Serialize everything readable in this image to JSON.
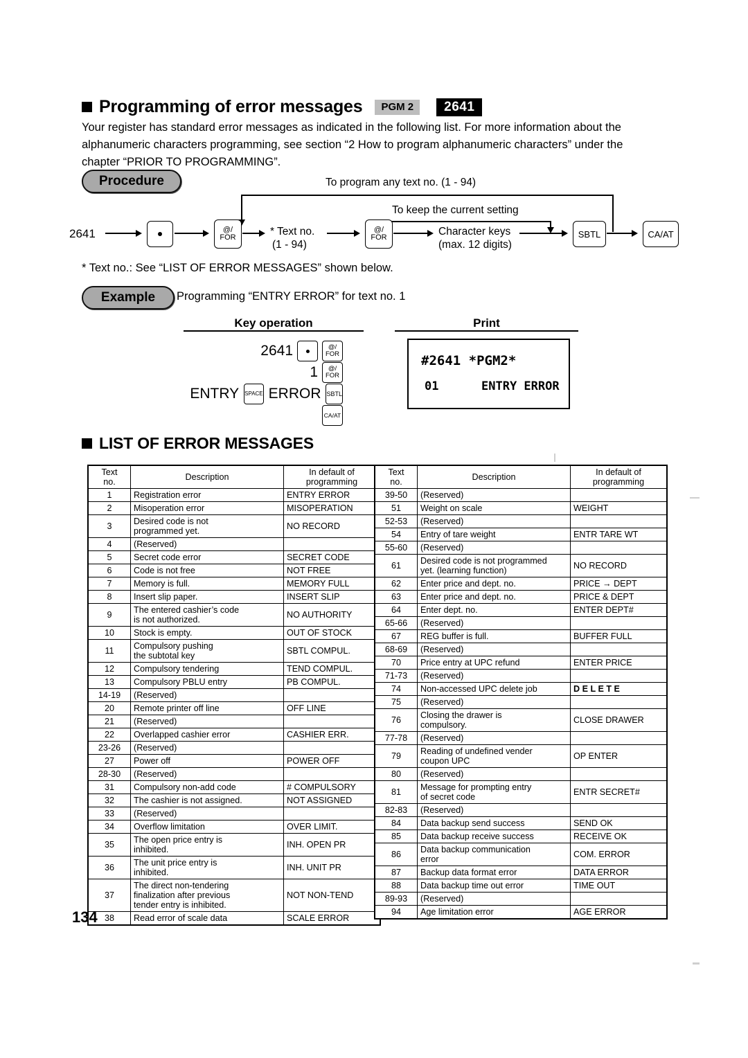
{
  "heading": {
    "title": "Programming of error messages",
    "badge_mode": "PGM 2",
    "badge_code": "2641",
    "bullet": "black-square"
  },
  "intro": "Your register has standard error messages as indicated in the following list. For more information about the alphanumeric characters programming, see section “2 How to program alphanumeric characters” under the chapter “PRIOR TO PROGRAMMING”.",
  "procedure": {
    "label": "Procedure",
    "start_code": "2641",
    "loop_top_label": "To program any text no. (1 - 94)",
    "loop_inner_label": "To keep the current setting",
    "keys": {
      "point": "•",
      "for1_top": "@/",
      "for1_bottom": "FOR",
      "for2_top": "@/",
      "for2_bottom": "FOR",
      "sbtl": "SBTL",
      "caat": "CA/AT"
    },
    "text_no_line1": "* Text no.",
    "text_no_line2": "(1 - 94)",
    "char_keys_line1": "Character keys",
    "char_keys_line2": "(max. 12 digits)",
    "footnote": "*  Text no.: See “LIST OF ERROR MESSAGES” shown below."
  },
  "example": {
    "label": "Example",
    "description": "Programming “ENTRY ERROR” for text no. 1",
    "key_operation_header": "Key operation",
    "print_header": "Print",
    "key_lines": [
      {
        "text": "2641",
        "keys": [
          "dot",
          "for"
        ]
      },
      {
        "text": "1",
        "keys": [
          "for"
        ]
      },
      {
        "text": "ENTRY",
        "keys": [
          "space"
        ],
        "text2": "ERROR",
        "keys2": [
          "sbtl"
        ]
      },
      {
        "text": "",
        "keys": [
          "caat"
        ]
      }
    ],
    "key_labels": {
      "dot": "•",
      "for_top": "@/",
      "for_bottom": "FOR",
      "space": "SPACE",
      "sbtl": "SBTL",
      "caat": "CA/AT"
    },
    "print": {
      "line1": "#2641 *PGM2*",
      "line2_left": "01",
      "line2_right": "ENTRY ERROR"
    }
  },
  "list_heading": "LIST OF ERROR MESSAGES",
  "table_headers": {
    "no": "Text\nno.",
    "no_line1": "Text",
    "no_line2": "no.",
    "description": "Description",
    "default_line1": "In default of",
    "default_line2": "programming"
  },
  "table_left": [
    {
      "no": "1",
      "desc": "Registration error",
      "def": "ENTRY ERROR"
    },
    {
      "no": "2",
      "desc": "Misoperation error",
      "def": "MISOPERATION"
    },
    {
      "no": "3",
      "desc": "Desired code is not\nprogrammed yet.",
      "def": "NO RECORD"
    },
    {
      "no": "4",
      "desc": "(Reserved)",
      "def": ""
    },
    {
      "no": "5",
      "desc": "Secret code error",
      "def": "SECRET CODE"
    },
    {
      "no": "6",
      "desc": "Code is not free",
      "def": "NOT FREE"
    },
    {
      "no": "7",
      "desc": "Memory is full.",
      "def": "MEMORY FULL"
    },
    {
      "no": "8",
      "desc": "Insert slip paper.",
      "def": "INSERT SLIP"
    },
    {
      "no": "9",
      "desc": "The entered cashier’s code\nis not authorized.",
      "def": "NO AUTHORITY"
    },
    {
      "no": "10",
      "desc": "Stock is empty.",
      "def": "OUT OF STOCK"
    },
    {
      "no": "11",
      "desc": "Compulsory pushing\nthe subtotal key",
      "def": "SBTL COMPUL."
    },
    {
      "no": "12",
      "desc": "Compulsory tendering",
      "def": "TEND COMPUL."
    },
    {
      "no": "13",
      "desc": "Compulsory PBLU entry",
      "def": "PB COMPUL."
    },
    {
      "no": "14-19",
      "desc": "(Reserved)",
      "def": ""
    },
    {
      "no": "20",
      "desc": "Remote printer off line",
      "def": "OFF LINE"
    },
    {
      "no": "21",
      "desc": "(Reserved)",
      "def": ""
    },
    {
      "no": "22",
      "desc": "Overlapped cashier error",
      "def": "CASHIER ERR."
    },
    {
      "no": "23-26",
      "desc": "(Reserved)",
      "def": ""
    },
    {
      "no": "27",
      "desc": "Power off",
      "def": "POWER OFF"
    },
    {
      "no": "28-30",
      "desc": "(Reserved)",
      "def": ""
    },
    {
      "no": "31",
      "desc": "Compulsory non-add code",
      "def": "# COMPULSORY"
    },
    {
      "no": "32",
      "desc": "The cashier is not assigned.",
      "def": "NOT ASSIGNED"
    },
    {
      "no": "33",
      "desc": "(Reserved)",
      "def": ""
    },
    {
      "no": "34",
      "desc": "Overflow limitation",
      "def": "OVER LIMIT."
    },
    {
      "no": "35",
      "desc": "The open price entry is\ninhibited.",
      "def": "INH. OPEN PR"
    },
    {
      "no": "36",
      "desc": "The unit price entry is\ninhibited.",
      "def": "INH. UNIT PR"
    },
    {
      "no": "37",
      "desc": "The direct non-tendering\nfinalization after previous\ntender entry is inhibited.",
      "def": "NOT NON-TEND"
    },
    {
      "no": "38",
      "desc": "Read error of scale data",
      "def": "SCALE ERROR"
    }
  ],
  "table_right": [
    {
      "no": "39-50",
      "desc": "(Reserved)",
      "def": ""
    },
    {
      "no": "51",
      "desc": "Weight on scale",
      "def": "WEIGHT"
    },
    {
      "no": "52-53",
      "desc": "(Reserved)",
      "def": ""
    },
    {
      "no": "54",
      "desc": "Entry of tare weight",
      "def": "ENTR TARE WT"
    },
    {
      "no": "55-60",
      "desc": "(Reserved)",
      "def": ""
    },
    {
      "no": "61",
      "desc": "Desired code is not programmed\nyet. (learning function)",
      "def": "NO RECORD"
    },
    {
      "no": "62",
      "desc": "Enter price and dept. no.",
      "def": "PRICE → DEPT"
    },
    {
      "no": "63",
      "desc": "Enter price and dept. no.",
      "def": "PRICE & DEPT"
    },
    {
      "no": "64",
      "desc": "Enter dept. no.",
      "def": "ENTER DEPT#"
    },
    {
      "no": "65-66",
      "desc": "(Reserved)",
      "def": ""
    },
    {
      "no": "67",
      "desc": "REG buffer is full.",
      "def": "BUFFER FULL"
    },
    {
      "no": "68-69",
      "desc": "(Reserved)",
      "def": ""
    },
    {
      "no": "70",
      "desc": "Price entry at UPC refund",
      "def": "ENTER PRICE"
    },
    {
      "no": "71-73",
      "desc": "(Reserved)",
      "def": ""
    },
    {
      "no": "74",
      "desc": "Non-accessed UPC delete job",
      "def": "D E L E T E",
      "def_bold": true
    },
    {
      "no": "75",
      "desc": "(Reserved)",
      "def": ""
    },
    {
      "no": "76",
      "desc": "Closing the drawer is\ncompulsory.",
      "def": "CLOSE DRAWER"
    },
    {
      "no": "77-78",
      "desc": "(Reserved)",
      "def": ""
    },
    {
      "no": "79",
      "desc": "Reading of undefined vender\ncoupon UPC",
      "def": "OP ENTER"
    },
    {
      "no": "80",
      "desc": "(Reserved)",
      "def": ""
    },
    {
      "no": "81",
      "desc": "Message for prompting entry\nof secret code",
      "def": "ENTR SECRET#"
    },
    {
      "no": "82-83",
      "desc": "(Reserved)",
      "def": ""
    },
    {
      "no": "84",
      "desc": "Data backup send success",
      "def": "SEND OK"
    },
    {
      "no": "85",
      "desc": "Data backup receive success",
      "def": "RECEIVE OK"
    },
    {
      "no": "86",
      "desc": "Data backup communication\nerror",
      "def": "COM. ERROR"
    },
    {
      "no": "87",
      "desc": "Backup data format error",
      "def": "DATA ERROR"
    },
    {
      "no": "88",
      "desc": "Data backup time out error",
      "def": "TIME OUT"
    },
    {
      "no": "89-93",
      "desc": "(Reserved)",
      "def": ""
    },
    {
      "no": "94",
      "desc": "Age limitation error",
      "def": "AGE ERROR"
    }
  ],
  "page_number": "134",
  "colors": {
    "badge_gray": "#bdbdbd",
    "badge_black": "#000000",
    "pill_fill": "#a9a9a9",
    "text": "#000000"
  }
}
